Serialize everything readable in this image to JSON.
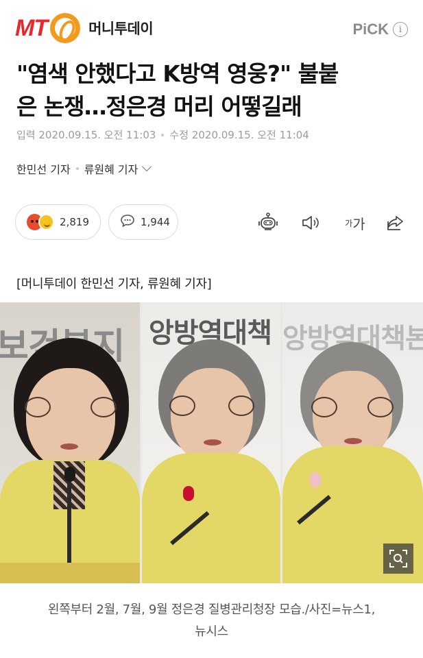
{
  "header": {
    "logo_text": "MT",
    "site_name": "머니투데이",
    "pick_label": "PiCK",
    "info_icon": "i"
  },
  "article": {
    "headline_line1": "\"염색 안했다고 K방역 영웅?\" 불붙",
    "headline_line2": "은 논쟁…정은경 머리 어떻길래",
    "published_label": "입력",
    "published_time": "2020.09.15. 오전 11:03",
    "modified_label": "수정",
    "modified_time": "2020.09.15. 오전 11:04",
    "reporter1": "한민선 기자",
    "reporter2": "류원혜 기자",
    "byline_caption": "[머니투데이 한민선 기자, 류원혜 기자]",
    "photo_caption_line1": "왼쪽부터 2월, 7월, 9월 정은경 질병관리청장 모습./사진=뉴스1,",
    "photo_caption_line2": "뉴시스"
  },
  "actions": {
    "reaction_count": "2,819",
    "comment_count": "1,944",
    "font_small": "가",
    "font_large": "가",
    "icons": [
      "angry-emoji",
      "smile-emoji",
      "comment-icon",
      "robot-icon",
      "speaker-icon",
      "font-size-icon",
      "share-icon",
      "zoom-icon"
    ]
  },
  "photo": {
    "panel1_sign": "보건복지",
    "panel2_sign": "앙방역대책",
    "panel3_sign": "앙방역대책본"
  },
  "colors": {
    "logo_red": "#e8262c",
    "logo_orange": "#f39a1c",
    "jacket_yellow": "#e3d865"
  }
}
